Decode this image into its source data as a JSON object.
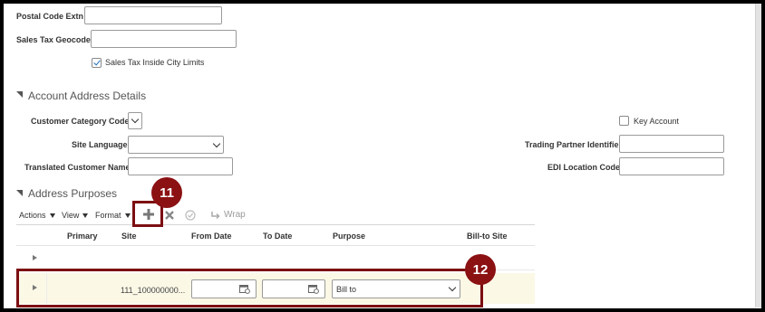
{
  "address_fields": {
    "postal_code_extn_label": "Postal Code Extn",
    "sales_tax_geocode_label": "Sales Tax Geocode",
    "sales_tax_inside_city_limits_label": "Sales Tax Inside City Limits",
    "sales_tax_inside_city_limits_checked": true
  },
  "account_address_details": {
    "title": "Account Address Details",
    "customer_category_code_label": "Customer Category Code",
    "site_language_label": "Site Language",
    "translated_customer_name_label": "Translated Customer Name",
    "key_account_label": "Key Account",
    "trading_partner_identifier_label": "Trading Partner Identifier",
    "edi_location_code_label": "EDI Location Code"
  },
  "address_purposes": {
    "title": "Address Purposes",
    "toolbar": {
      "actions_label": "Actions",
      "view_label": "View",
      "format_label": "Format",
      "wrap_label": "Wrap"
    },
    "columns": [
      "Primary",
      "Site",
      "From Date",
      "To Date",
      "Purpose",
      "Bill-to Site"
    ],
    "rows": [
      {
        "site": "",
        "from_date": "",
        "to_date": "",
        "purpose": ""
      },
      {
        "site": "111_100000000...",
        "from_date": "",
        "to_date": "",
        "purpose": "Bill to"
      }
    ]
  },
  "callouts": {
    "badge_add": "11",
    "badge_row": "12"
  },
  "colors": {
    "callout": "#8b1113",
    "highlight_row": "#fbf8e6",
    "checkbox_check": "#1c6fb8"
  }
}
